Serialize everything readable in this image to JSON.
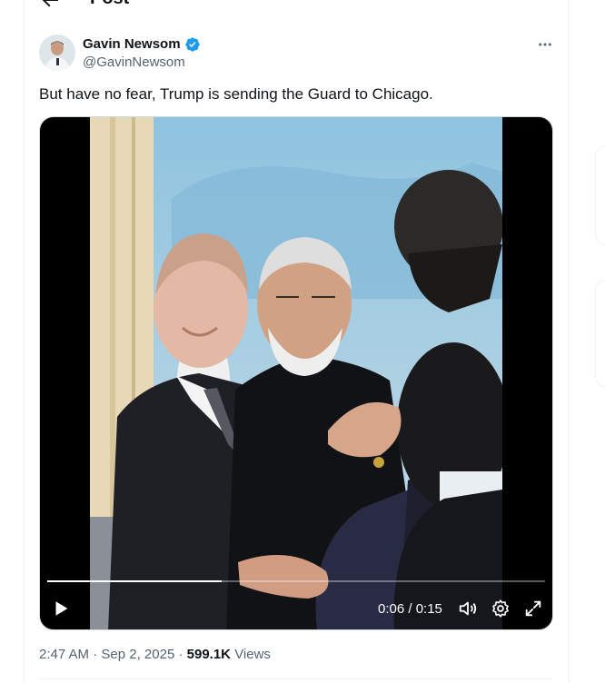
{
  "header": {
    "title": "Post"
  },
  "tweet": {
    "author_name": "Gavin Newsom",
    "handle": "@GavinNewsom",
    "text": "But have no fear, Trump is sending the Guard to Chicago.",
    "time": "2:47 AM",
    "date": "Sep 2, 2025",
    "views_count": "599.1K",
    "views_label": "Views",
    "separator": " · "
  },
  "video": {
    "time_display": "0:06 / 0:15",
    "progress": 0.35
  },
  "icons": {
    "back": "arrow-left-icon",
    "verified": "verified-badge-icon",
    "more": "more-horizontal-icon",
    "play": "play-icon",
    "volume": "volume-icon",
    "settings": "gear-icon",
    "fullscreen": "fullscreen-icon"
  },
  "colors": {
    "verified": "#1d9bf0",
    "text": "#0f1419",
    "secondary": "#536471"
  }
}
